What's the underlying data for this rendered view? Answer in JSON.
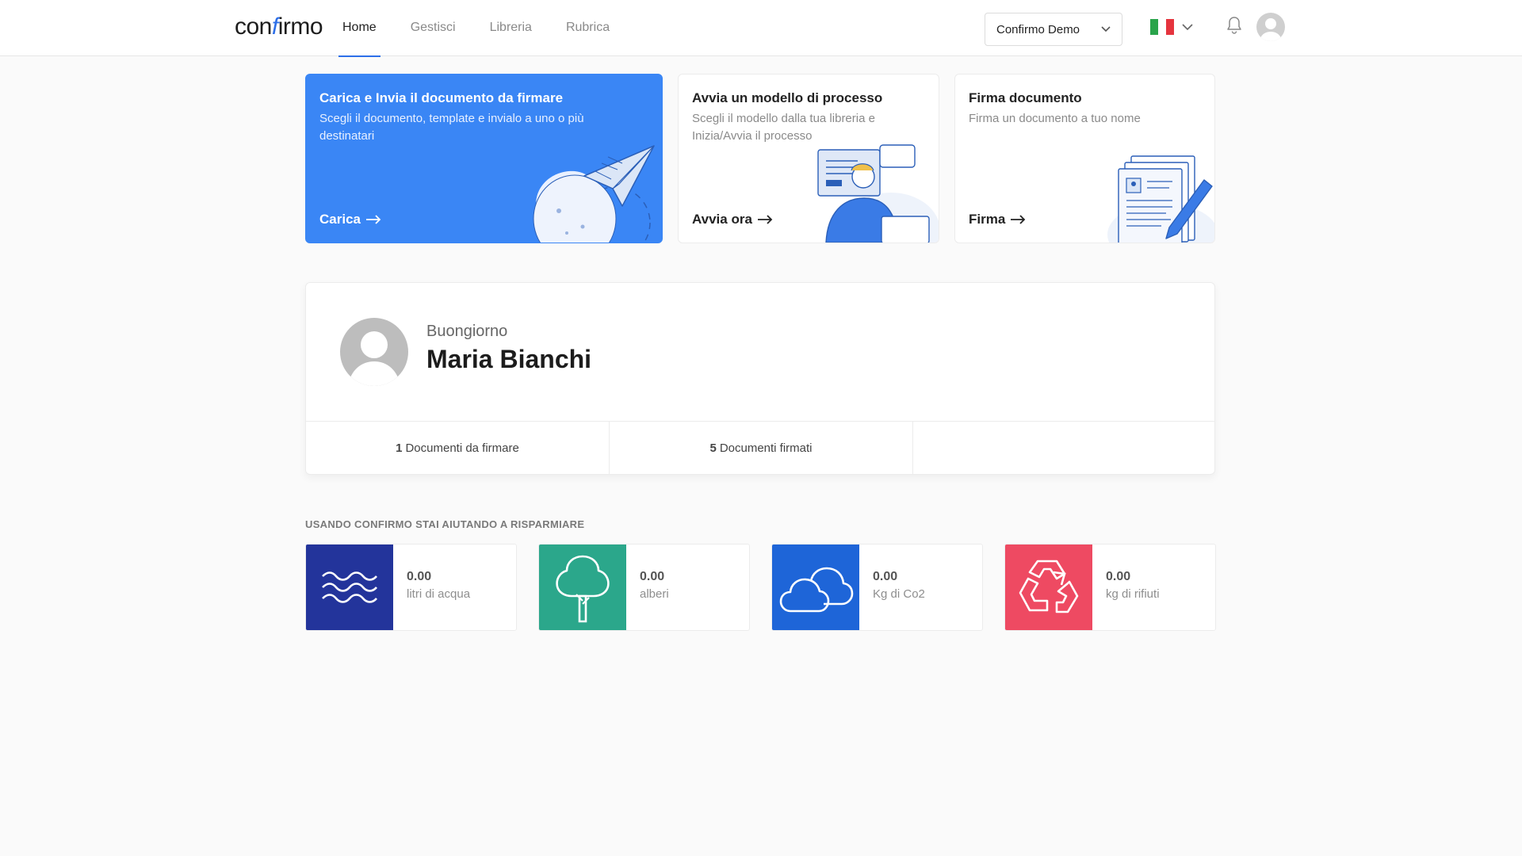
{
  "app": {
    "logo_pre": "con",
    "logo_f": "f",
    "logo_post": "irmo"
  },
  "nav": [
    {
      "label": "Home",
      "active": true
    },
    {
      "label": "Gestisci"
    },
    {
      "label": "Libreria"
    },
    {
      "label": "Rubrica"
    }
  ],
  "header": {
    "account": "Confirmo Demo",
    "language_flag": "italy-flag-icon"
  },
  "cards": [
    {
      "title": "Carica e Invia il documento da firmare",
      "desc": "Scegli il documento, template e invialo a uno o più destinatari",
      "cta": "Carica"
    },
    {
      "title": "Avvia un modello di processo",
      "desc": "Scegli il modello dalla tua libreria e Inizia/Avvia il processo",
      "cta": "Avvia ora"
    },
    {
      "title": "Firma documento",
      "desc": "Firma un documento a tuo nome",
      "cta": "Firma"
    }
  ],
  "greeting": {
    "hello": "Buongiorno",
    "name": "Maria Bianchi",
    "to_sign_count": "1",
    "to_sign_label": "Documenti da firmare",
    "signed_count": "5",
    "signed_label": "Documenti firmati"
  },
  "savings": {
    "title": "USANDO CONFIRMO STAI AIUTANDO A RISPARMIARE",
    "items": [
      {
        "value": "0.00",
        "label": "litri di acqua",
        "icon": "water-waves-icon",
        "color": "#23349b"
      },
      {
        "value": "0.00",
        "label": "alberi",
        "icon": "tree-icon",
        "color": "#2ba78b"
      },
      {
        "value": "0.00",
        "label": "Kg di Co2",
        "icon": "cloud-icon",
        "color": "#1e65d8"
      },
      {
        "value": "0.00",
        "label": "kg di rifiuti",
        "icon": "recycle-icon",
        "color": "#ee4a62"
      }
    ]
  },
  "colors": {
    "accent": "#2d6fe8",
    "primary_card": "#3a86f5"
  }
}
